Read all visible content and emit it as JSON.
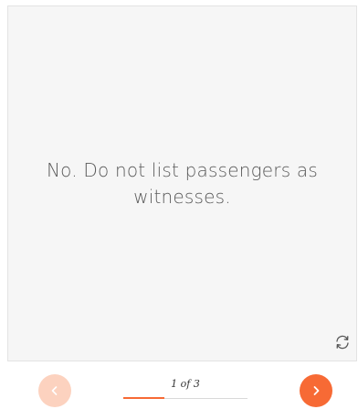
{
  "card": {
    "text": "No.  Do not list passengers as witnesses."
  },
  "pager": {
    "label": "1 of 3",
    "current": 1,
    "total": 3,
    "progress_fraction": 0.333
  },
  "icons": {
    "flip": "flip-card-icon",
    "prev": "chevron-left-icon",
    "next": "chevron-right-icon"
  },
  "colors": {
    "accent": "#f76a35",
    "accent_disabled": "#fcd2bf",
    "card_bg": "#f6f6f6",
    "text": "#5a5a5a"
  }
}
